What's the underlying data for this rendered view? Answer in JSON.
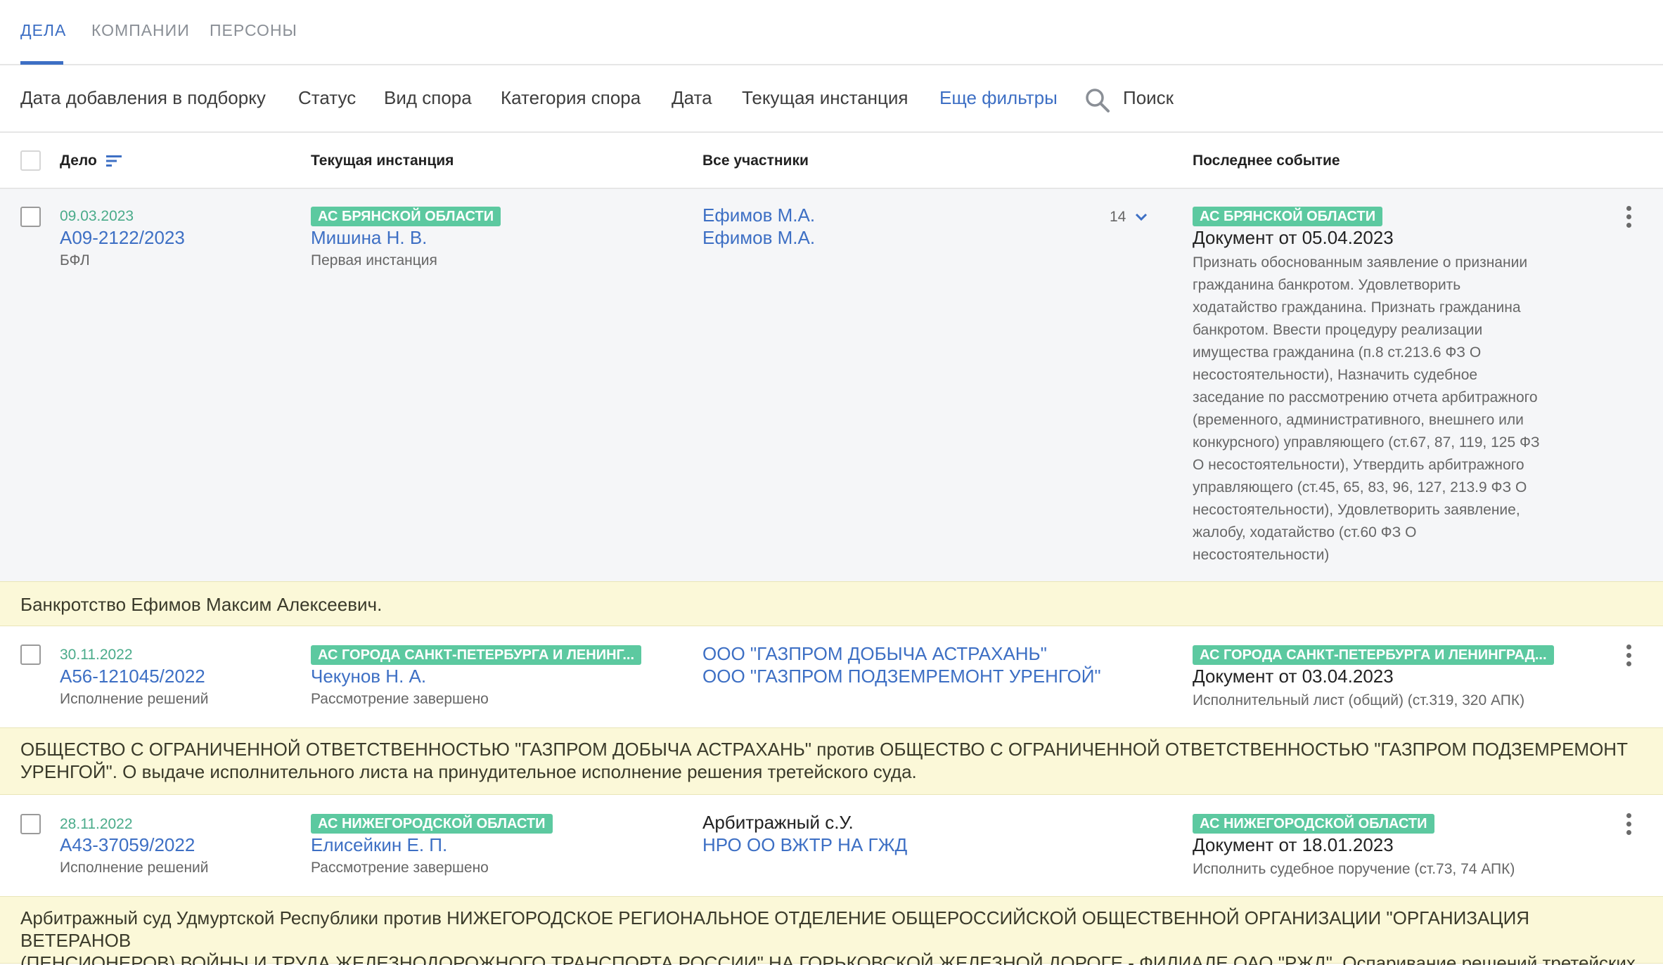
{
  "tabs": [
    {
      "label": "ДЕЛА"
    },
    {
      "label": "КОМПАНИИ"
    },
    {
      "label": "ПЕРСОНЫ"
    }
  ],
  "filters": {
    "added_date": "Дата добавления в подборку",
    "status": "Статус",
    "dispute_type": "Вид спора",
    "dispute_category": "Категория спора",
    "date": "Дата",
    "current_instance": "Текущая инстанция",
    "more_filters": "Еще фильтры",
    "search": "Поиск"
  },
  "columns": {
    "case": "Дело",
    "instance": "Текущая инстанция",
    "participants": "Все участники",
    "last_event": "Последнее событие"
  },
  "colors": {
    "accent": "#3d6fc4",
    "badge": "#5cc9a0",
    "date_green": "#4aab8a",
    "description_bg": "#fbf8d8"
  },
  "rows": [
    {
      "date": "09.03.2023",
      "number": "А09-2122/2023",
      "type": "БФЛ",
      "court": "АС БРЯНСКОЙ ОБЛАСТИ",
      "judge": "Мишина Н. В.",
      "stage": "Первая инстанция",
      "participants": [
        "Ефимов М.А.",
        "Ефимов М.А."
      ],
      "participants_count": "14",
      "event_court": "АС БРЯНСКОЙ ОБЛАСТИ",
      "event_doc": "Документ от 05.04.2023",
      "event_lines": [
        "Признать обоснованным заявление о признании",
        "гражданина банкротом. Удовлетворить",
        "ходатайство гражданина. Признать гражданина",
        "банкротом. Ввести процедуру реализации",
        "имущества гражданина (п.8 ст.213.6 ФЗ О",
        "несостоятельности), Назначить судебное",
        "заседание по рассмотрению отчета арбитражного",
        "(временного, административного, внешнего или",
        "конкурсного) управляющего (ст.67, 87, 119, 125 ФЗ",
        "О несостоятельности), Утвердить арбитражного",
        "управляющего (ст.45, 65, 83, 96, 127, 213.9 ФЗ О",
        "несостоятельности), Удовлетворить заявление,",
        "жалобу, ходатайство (ст.60 ФЗ О",
        "несостоятельности)"
      ],
      "description": [
        "Банкротство Ефимов Максим Алексеевич."
      ]
    },
    {
      "date": "30.11.2022",
      "number": "А56-121045/2022",
      "type": "Исполнение решений",
      "court": "АС ГОРОДА САНКТ-ПЕТЕРБУРГА И ЛЕНИНГ...",
      "judge": "Чекунов Н. А.",
      "stage": "Рассмотрение завершено",
      "participants": [
        "ООО \"ГАЗПРОМ ДОБЫЧА АСТРАХАНЬ\"",
        "ООО \"ГАЗПРОМ ПОДЗЕМРЕМОНТ УРЕНГОЙ\""
      ],
      "event_court": "АС ГОРОДА САНКТ-ПЕТЕРБУРГА И ЛЕНИНГРАД...",
      "event_doc": "Документ от 03.04.2023",
      "event_lines": [
        "Исполнительный лист (общий) (ст.319, 320 АПК)"
      ],
      "description": [
        "ОБЩЕСТВО С ОГРАНИЧЕННОЙ ОТВЕТСТВЕННОСТЬЮ \"ГАЗПРОМ ДОБЫЧА АСТРАХАНЬ\" против ОБЩЕСТВО С ОГРАНИЧЕННОЙ ОТВЕТСТВЕННОСТЬЮ \"ГАЗПРОМ ПОДЗЕМРЕМОНТ",
        "УРЕНГОЙ\". О выдаче исполнительного листа на принудительное исполнение решения третейского суда."
      ]
    },
    {
      "date": "28.11.2022",
      "number": "А43-37059/2022",
      "type": "Исполнение решений",
      "court": "АС НИЖЕГОРОДСКОЙ ОБЛАСТИ",
      "judge": "Елисейкин Е. П.",
      "stage": "Рассмотрение завершено",
      "participant_plain": "Арбитражный с.У.",
      "participant_link": "НРО ОО ВЖТР НА ГЖД",
      "event_court": "АС НИЖЕГОРОДСКОЙ ОБЛАСТИ",
      "event_doc": "Документ от 18.01.2023",
      "event_lines": [
        "Исполнить судебное поручение (ст.73, 74 АПК)"
      ],
      "description": [
        "Арбитражный суд Удмуртской Республики против НИЖЕГОРОДСКОЕ РЕГИОНАЛЬНОЕ ОТДЕЛЕНИЕ ОБЩЕРОССИЙСКОЙ ОБЩЕСТВЕННОЙ ОРГАНИЗАЦИИ \"ОРГАНИЗАЦИЯ ВЕТЕРАНОВ",
        "(ПЕНСИОНЕРОВ) ВОЙНЫ И ТРУДА ЖЕЛЕЗНОДОРОЖНОГО ТРАНСПОРТА РОССИИ\" НА ГОРЬКОВСКОЙ ЖЕЛЕЗНОЙ ДОРОГЕ - ФИЛИАЛЕ ОАО \"РЖД\". Оспаривание решений третейских судов."
      ]
    }
  ]
}
